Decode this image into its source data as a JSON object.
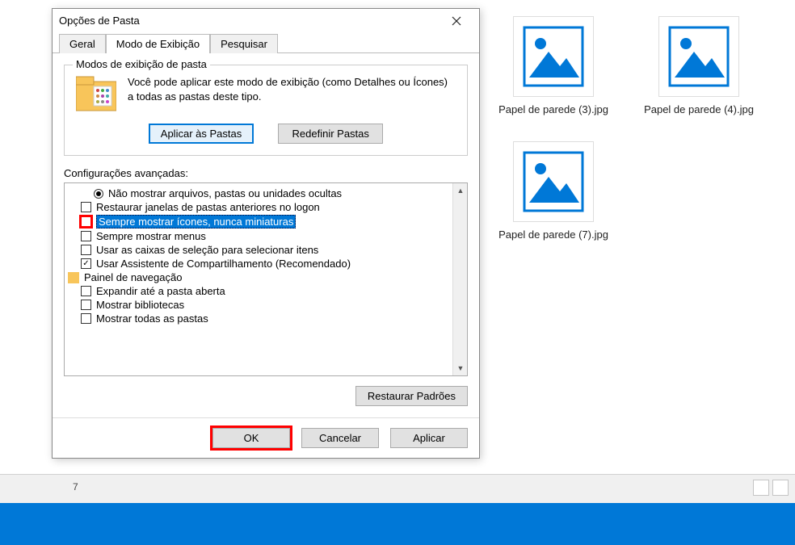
{
  "desktop": {
    "item_count": "7",
    "files": [
      {
        "label": "Papel de parede (3).jpg"
      },
      {
        "label": "Papel de parede (4).jpg"
      },
      {
        "label": "Papel de parede (7).jpg"
      }
    ]
  },
  "dialog": {
    "title": "Opções de Pasta",
    "tabs": {
      "general": "Geral",
      "view": "Modo de Exibição",
      "search": "Pesquisar"
    },
    "folder_views": {
      "group_label": "Modos de exibição de pasta",
      "description": "Você pode aplicar este modo de exibição (como Detalhes ou Ícones) a todas as pastas deste tipo.",
      "apply_btn": "Aplicar às Pastas",
      "reset_btn": "Redefinir Pastas"
    },
    "advanced": {
      "label": "Configurações avançadas:",
      "items": [
        {
          "type": "radio",
          "checked": true,
          "text": "Não mostrar arquivos, pastas ou unidades ocultas"
        },
        {
          "type": "check",
          "checked": false,
          "text": "Restaurar janelas de pastas anteriores no logon"
        },
        {
          "type": "check",
          "checked": false,
          "text": "Sempre mostrar ícones, nunca miniaturas",
          "selected": true,
          "redbox": true
        },
        {
          "type": "check",
          "checked": false,
          "text": "Sempre mostrar menus"
        },
        {
          "type": "check",
          "checked": false,
          "text": "Usar as caixas de seleção para selecionar itens"
        },
        {
          "type": "check",
          "checked": true,
          "text": "Usar Assistente de Compartilhamento (Recomendado)"
        }
      ],
      "group2_label": "Painel de navegação",
      "group2_items": [
        {
          "type": "check",
          "checked": false,
          "text": "Expandir até a pasta aberta"
        },
        {
          "type": "check",
          "checked": false,
          "text": "Mostrar bibliotecas"
        },
        {
          "type": "check",
          "checked": false,
          "text": "Mostrar todas as pastas"
        }
      ],
      "restore_btn": "Restaurar Padrões"
    },
    "buttons": {
      "ok": "OK",
      "cancel": "Cancelar",
      "apply": "Aplicar"
    }
  }
}
